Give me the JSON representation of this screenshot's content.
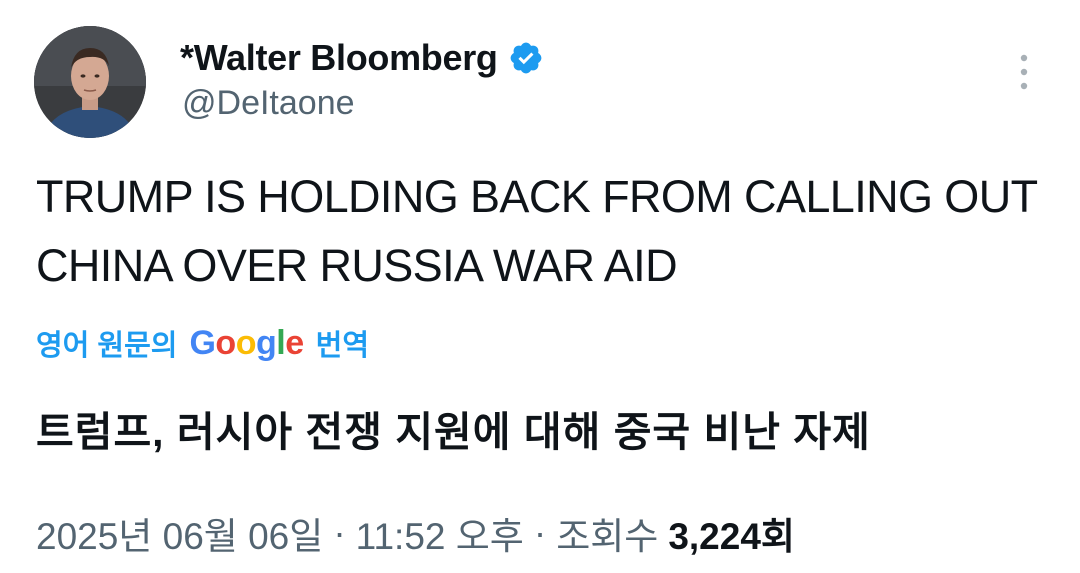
{
  "author": {
    "display_name": "*Walter Bloomberg",
    "handle": "@DeItaone",
    "verified": true,
    "avatar_icon": "avatar"
  },
  "tweet": {
    "text": "TRUMP IS HOLDING BACK FROM CALLING OUT CHINA OVER RUSSIA WAR AID",
    "translation_prefix": "영어 원문의",
    "translation_provider_parts": [
      "G",
      "o",
      "o",
      "g",
      "l",
      "e"
    ],
    "translation_suffix": "번역",
    "translated_text": "트럼프, 러시아 전쟁 지원에 대해 중국 비난 자제"
  },
  "meta": {
    "date": "2025년 06월 06일",
    "separator": "·",
    "time": "11:52 오후",
    "views_label": "조회수",
    "views_count": "3,224회"
  },
  "colors": {
    "link_blue": "#1d9bf0",
    "secondary_text": "#536471",
    "primary_text": "#0f1419",
    "verified_blue": "#1d9bf0"
  }
}
